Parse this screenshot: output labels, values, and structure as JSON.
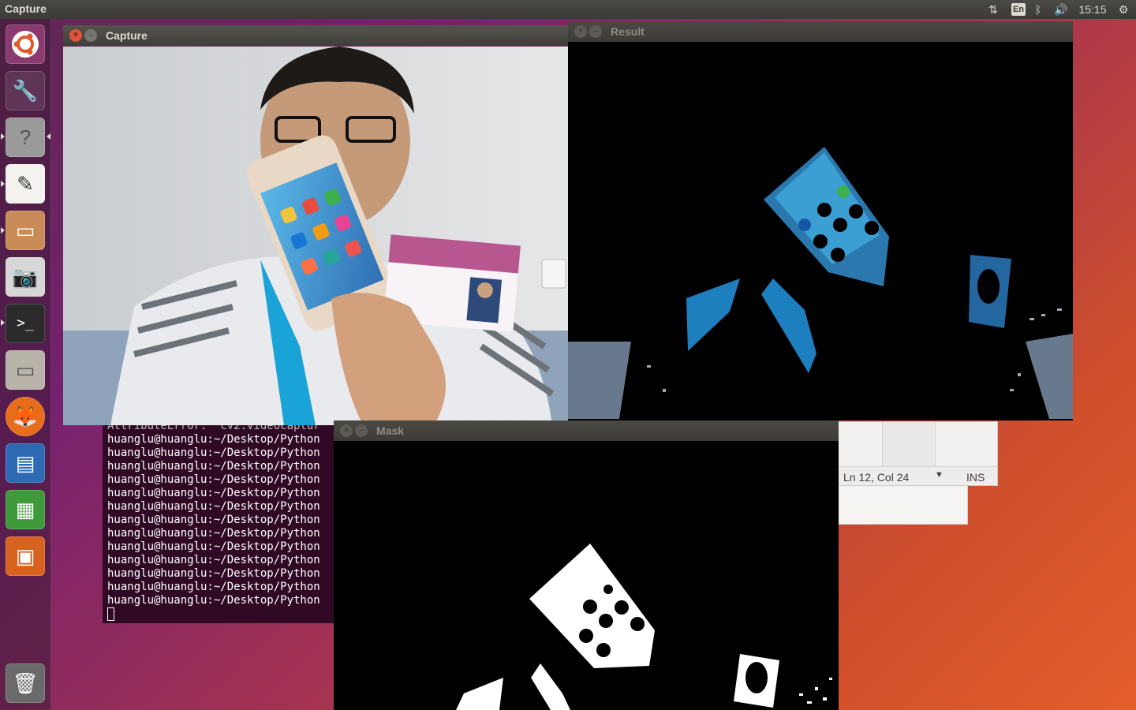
{
  "top_panel": {
    "app_title": "Capture",
    "lang": "En",
    "clock": "15:15",
    "icons": [
      "network-icon",
      "bluetooth-icon",
      "volume-icon",
      "settings-gear-icon"
    ]
  },
  "launcher": {
    "items": [
      "ubuntu-dash",
      "system-settings",
      "help",
      "text-editor",
      "files",
      "camera",
      "terminal",
      "files-2",
      "firefox",
      "writer",
      "calc",
      "impress",
      "trash"
    ]
  },
  "windows": {
    "capture": {
      "title": "Capture"
    },
    "result": {
      "title": "Result"
    },
    "mask": {
      "title": "Mask"
    }
  },
  "terminal": {
    "first_line": "AttributeError: 'cv2.VideoCaptur",
    "prompt_lines": [
      "huanglu@huanglu:~/Desktop/Python",
      "huanglu@huanglu:~/Desktop/Python",
      "huanglu@huanglu:~/Desktop/Python",
      "huanglu@huanglu:~/Desktop/Python",
      "huanglu@huanglu:~/Desktop/Python",
      "huanglu@huanglu:~/Desktop/Python",
      "huanglu@huanglu:~/Desktop/Python",
      "huanglu@huanglu:~/Desktop/Python",
      "huanglu@huanglu:~/Desktop/Python",
      "huanglu@huanglu:~/Desktop/Python",
      "huanglu@huanglu:~/Desktop/Python",
      "huanglu@huanglu:~/Desktop/Python",
      "huanglu@huanglu:~/Desktop/Python"
    ]
  },
  "editor": {
    "position": "Ln 12, Col 24",
    "mode": "INS"
  }
}
